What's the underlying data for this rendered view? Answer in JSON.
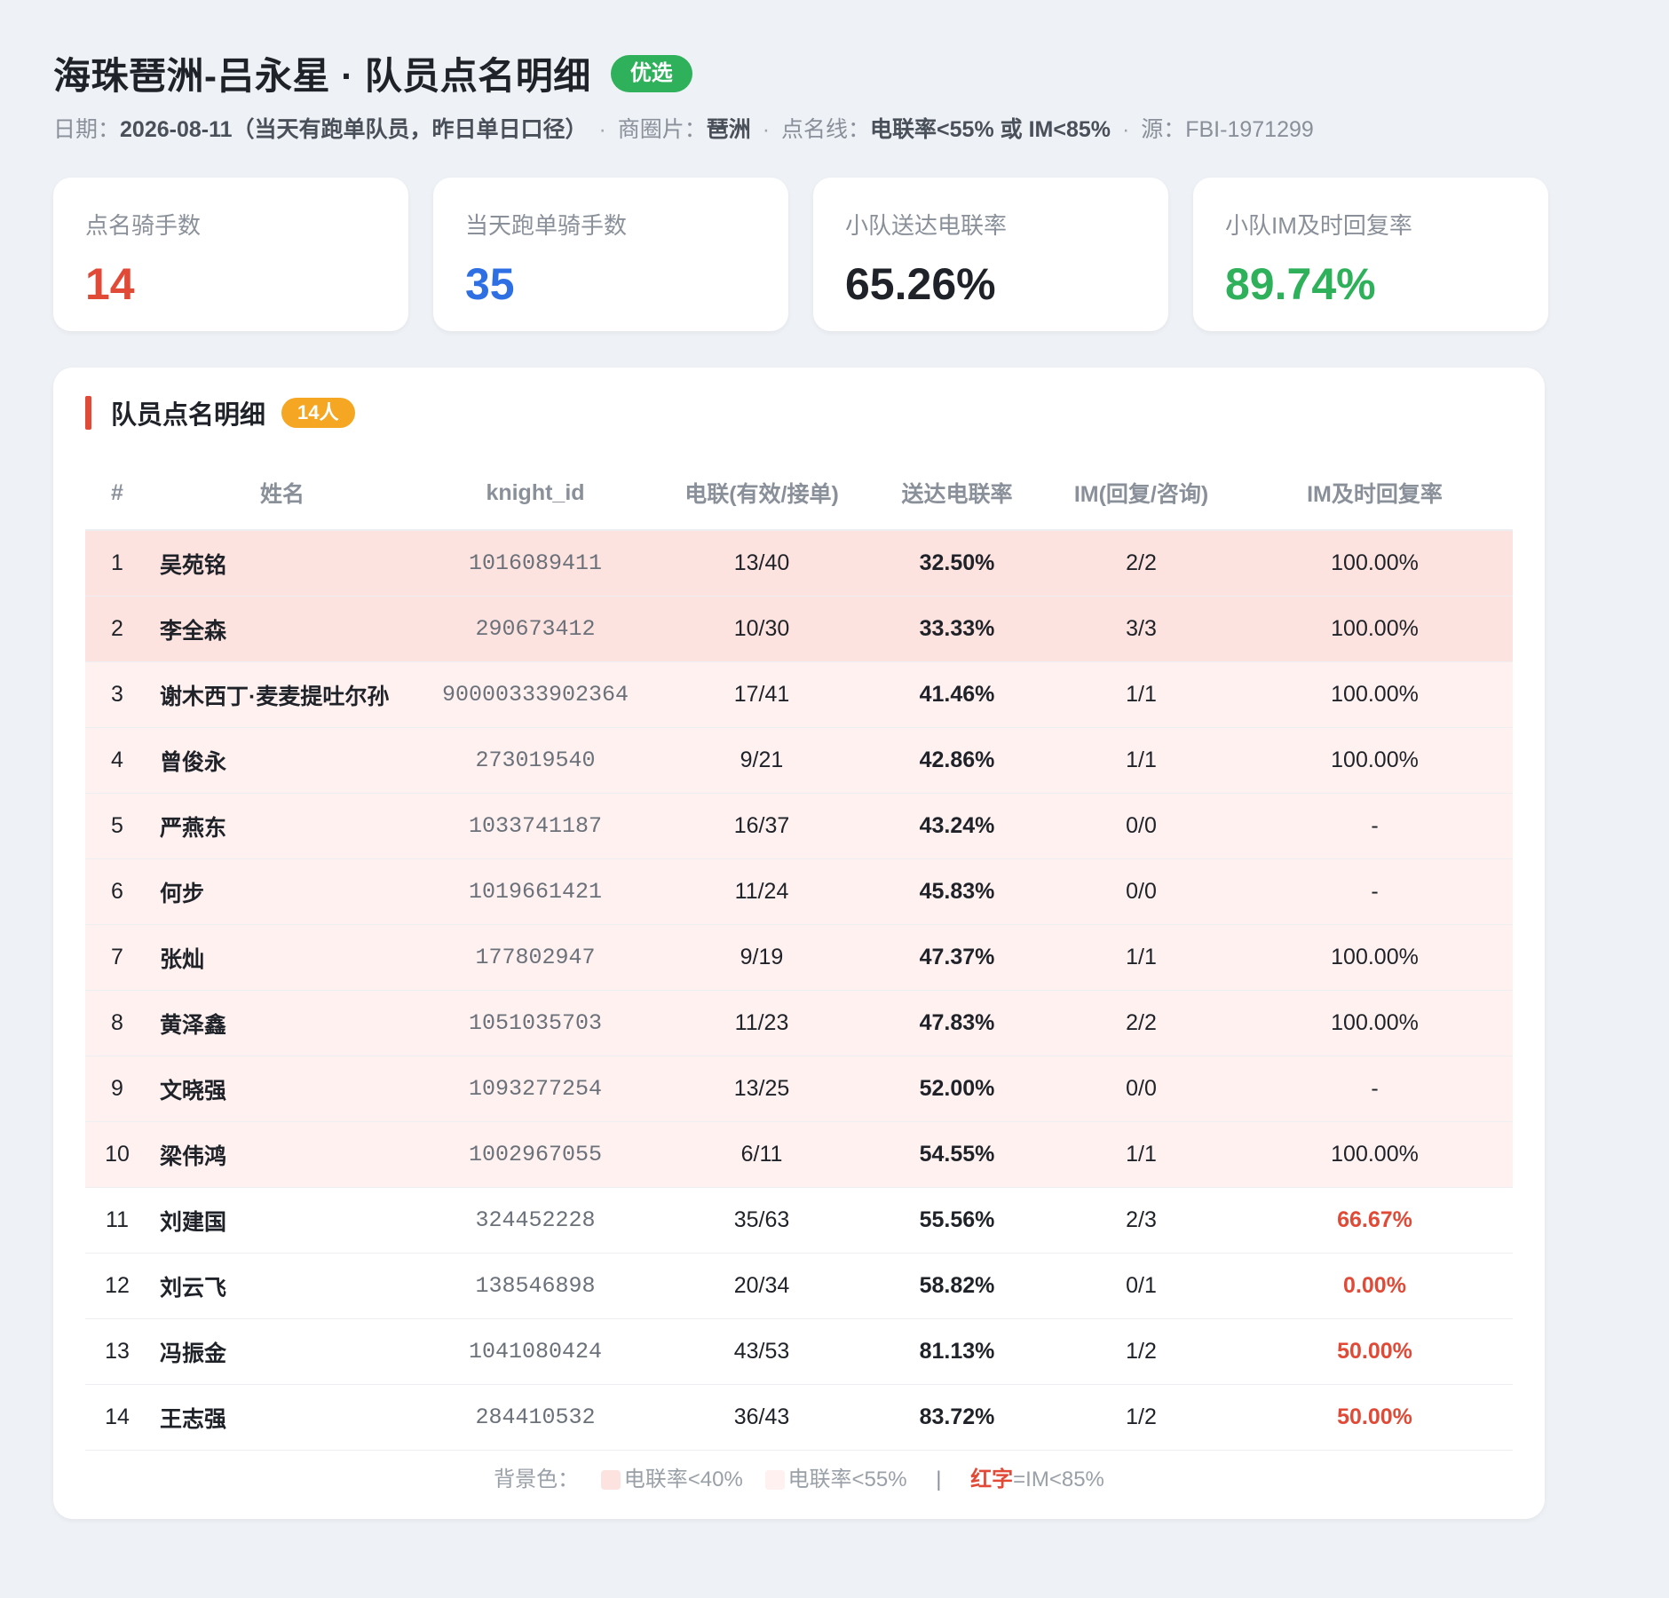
{
  "header": {
    "title": "海珠琶洲-吕永星 · 队员点名明细",
    "badge": "优选",
    "sub": {
      "date_label": "日期：",
      "date_value": "2026-08-11（当天有跑单队员，昨日单日口径）",
      "area_label": "商圈片：",
      "area_value": "琶洲",
      "line_label": "点名线：",
      "line_value": "电联率<55% 或 IM<85%",
      "source_label": "源：",
      "source_value": "FBI-1971299",
      "sep": "·"
    }
  },
  "kpis": [
    {
      "label": "点名骑手数",
      "value": "14",
      "color": "#e04a37"
    },
    {
      "label": "当天跑单骑手数",
      "value": "35",
      "color": "#2f6fe4"
    },
    {
      "label": "小队送达电联率",
      "value": "65.26%",
      "color": "#1f2329"
    },
    {
      "label": "小队IM及时回复率",
      "value": "89.74%",
      "color": "#2fb05a"
    }
  ],
  "panel": {
    "title": "队员点名明细",
    "count": "14人",
    "columns": [
      "#",
      "姓名",
      "knight_id",
      "电联(有效/接单)",
      "送达电联率",
      "IM(回复/咨询)",
      "IM及时回复率"
    ],
    "rows": [
      {
        "no": "1",
        "name": "吴苑铭",
        "kid": "1016089411",
        "calls": "13/40",
        "rate": "32.50%",
        "im": "2/2",
        "im_rate": "100.00%",
        "bg": "strong",
        "im_bad": false
      },
      {
        "no": "2",
        "name": "李全森",
        "kid": "290673412",
        "calls": "10/30",
        "rate": "33.33%",
        "im": "3/3",
        "im_rate": "100.00%",
        "bg": "strong",
        "im_bad": false
      },
      {
        "no": "3",
        "name": "谢木西丁·麦麦提吐尔孙",
        "kid": "90000333902364",
        "calls": "17/41",
        "rate": "41.46%",
        "im": "1/1",
        "im_rate": "100.00%",
        "bg": "light",
        "im_bad": false
      },
      {
        "no": "4",
        "name": "曾俊永",
        "kid": "273019540",
        "calls": "9/21",
        "rate": "42.86%",
        "im": "1/1",
        "im_rate": "100.00%",
        "bg": "light",
        "im_bad": false
      },
      {
        "no": "5",
        "name": "严燕东",
        "kid": "1033741187",
        "calls": "16/37",
        "rate": "43.24%",
        "im": "0/0",
        "im_rate": "-",
        "bg": "light",
        "im_bad": false
      },
      {
        "no": "6",
        "name": "何步",
        "kid": "1019661421",
        "calls": "11/24",
        "rate": "45.83%",
        "im": "0/0",
        "im_rate": "-",
        "bg": "light",
        "im_bad": false
      },
      {
        "no": "7",
        "name": "张灿",
        "kid": "177802947",
        "calls": "9/19",
        "rate": "47.37%",
        "im": "1/1",
        "im_rate": "100.00%",
        "bg": "light",
        "im_bad": false
      },
      {
        "no": "8",
        "name": "黄泽鑫",
        "kid": "1051035703",
        "calls": "11/23",
        "rate": "47.83%",
        "im": "2/2",
        "im_rate": "100.00%",
        "bg": "light",
        "im_bad": false
      },
      {
        "no": "9",
        "name": "文晓强",
        "kid": "1093277254",
        "calls": "13/25",
        "rate": "52.00%",
        "im": "0/0",
        "im_rate": "-",
        "bg": "light",
        "im_bad": false
      },
      {
        "no": "10",
        "name": "梁伟鸿",
        "kid": "1002967055",
        "calls": "6/11",
        "rate": "54.55%",
        "im": "1/1",
        "im_rate": "100.00%",
        "bg": "light",
        "im_bad": false
      },
      {
        "no": "11",
        "name": "刘建国",
        "kid": "324452228",
        "calls": "35/63",
        "rate": "55.56%",
        "im": "2/3",
        "im_rate": "66.67%",
        "bg": "none",
        "im_bad": true
      },
      {
        "no": "12",
        "name": "刘云飞",
        "kid": "138546898",
        "calls": "20/34",
        "rate": "58.82%",
        "im": "0/1",
        "im_rate": "0.00%",
        "bg": "none",
        "im_bad": true
      },
      {
        "no": "13",
        "name": "冯振金",
        "kid": "1041080424",
        "calls": "43/53",
        "rate": "81.13%",
        "im": "1/2",
        "im_rate": "50.00%",
        "bg": "none",
        "im_bad": true
      },
      {
        "no": "14",
        "name": "王志强",
        "kid": "284410532",
        "calls": "36/43",
        "rate": "83.72%",
        "im": "1/2",
        "im_rate": "50.00%",
        "bg": "none",
        "im_bad": true
      }
    ]
  },
  "legend": {
    "label": "背景色：",
    "strong": "电联率<40%",
    "light": "电联率<55%",
    "pipe": "|",
    "red_word": "红字",
    "red_rest": "=IM<85%"
  },
  "colors": {
    "accent_red": "#e04a37",
    "accent_blue": "#2f6fe4",
    "accent_green": "#2fb05a",
    "badge_orange": "#f5a623",
    "row_strong_bg": "#fde3df",
    "row_light_bg": "#fef1ef"
  }
}
